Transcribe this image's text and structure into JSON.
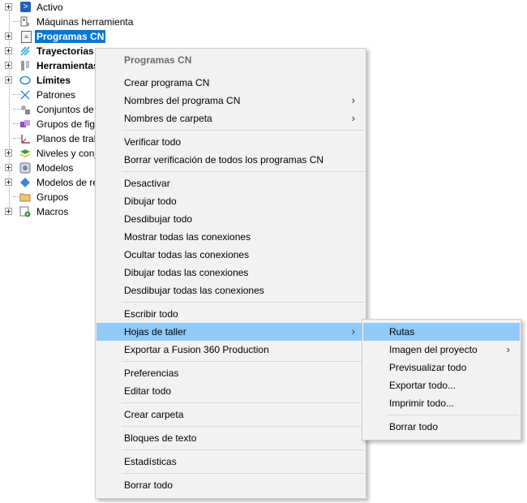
{
  "tree": {
    "items": [
      {
        "label": "Activo",
        "icon": "activo-icon",
        "bold": false,
        "selected": false
      },
      {
        "label": "Máquinas herramienta",
        "icon": "machine-tool-icon",
        "bold": false,
        "selected": false
      },
      {
        "label": "Programas CN",
        "icon": "nc-program-icon",
        "bold": true,
        "selected": true
      },
      {
        "label": "Trayectorias",
        "icon": "toolpath-icon",
        "bold": true,
        "selected": false
      },
      {
        "label": "Herramientas",
        "icon": "tools-icon",
        "bold": true,
        "selected": false
      },
      {
        "label": "Límites",
        "icon": "boundary-icon",
        "bold": true,
        "selected": false
      },
      {
        "label": "Patrones",
        "icon": "pattern-icon",
        "bold": false,
        "selected": false
      },
      {
        "label": "Conjuntos de",
        "icon": "feature-set-icon",
        "bold": false,
        "selected": false
      },
      {
        "label": "Grupos de figu",
        "icon": "feature-group-icon",
        "bold": false,
        "selected": false
      },
      {
        "label": "Planos de trab",
        "icon": "workplane-icon",
        "bold": false,
        "selected": false
      },
      {
        "label": "Niveles y conj",
        "icon": "levels-icon",
        "bold": false,
        "selected": false
      },
      {
        "label": "Modelos",
        "icon": "model-icon",
        "bold": false,
        "selected": false
      },
      {
        "label": "Modelos de re",
        "icon": "stock-model-icon",
        "bold": false,
        "selected": false
      },
      {
        "label": "Grupos",
        "icon": "group-folder-icon",
        "bold": false,
        "selected": false
      },
      {
        "label": "Macros",
        "icon": "macro-icon",
        "bold": false,
        "selected": false
      }
    ]
  },
  "context_menu": {
    "header": "Programas CN",
    "items": {
      "crear_programa": "Crear programa CN",
      "nombres_programa": "Nombres del programa CN",
      "nombres_carpeta": "Nombres de carpeta",
      "verificar_todo": "Verificar todo",
      "borrar_verificacion": "Borrar verificación de todos los programas CN",
      "desactivar": "Desactivar",
      "dibujar_todo": "Dibujar todo",
      "desdibujar_todo": "Desdibujar todo",
      "mostrar_conexiones": "Mostrar todas las conexiones",
      "ocultar_conexiones": "Ocultar todas las conexiones",
      "dibujar_conexiones": "Dibujar todas las conexiones",
      "desdibujar_conexiones": "Desdibujar todas las conexiones",
      "escribir_todo": "Escribir todo",
      "hojas_taller": "Hojas de taller",
      "exportar_fusion": "Exportar a Fusion 360 Production",
      "preferencias": "Preferencias",
      "editar_todo": "Editar todo",
      "crear_carpeta": "Crear carpeta",
      "bloques_texto": "Bloques de texto",
      "estadisticas": "Estadísticas",
      "borrar_todo": "Borrar todo"
    },
    "submenu_arrow": "›"
  },
  "submenu": {
    "items": {
      "rutas": "Rutas",
      "imagen_proyecto": "Imagen del proyecto",
      "previsualizar_todo": "Previsualizar todo",
      "exportar_todo": "Exportar todo...",
      "imprimir_todo": "Imprimir todo...",
      "borrar_todo": "Borrar todo"
    }
  },
  "colors": {
    "selection": "#0078d7",
    "menu_hover": "#91c9f7",
    "menu_bg": "#f2f2f2"
  }
}
